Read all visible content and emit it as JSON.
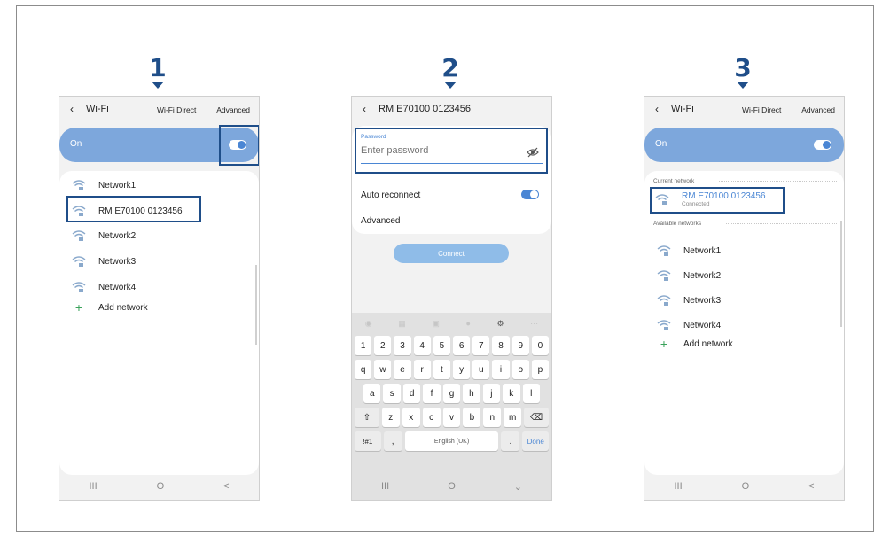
{
  "steps": [
    "1",
    "2",
    "3"
  ],
  "phone1": {
    "back_icon": "back-chevron",
    "title": "Wi-Fi",
    "wifi_direct": "Wi-Fi Direct",
    "advanced": "Advanced",
    "on_label": "On",
    "networks": [
      "Network1",
      "RM E70100 0123456",
      "Network2",
      "Network3",
      "Network4"
    ],
    "add_network": "Add network"
  },
  "phone2": {
    "back_icon": "back-chevron",
    "title": "RM E70100 0123456",
    "password_label": "Password",
    "password_placeholder": "Enter password",
    "auto_reconnect": "Auto reconnect",
    "advanced": "Advanced",
    "connect": "Connect",
    "keyboard": {
      "numbers": [
        "1",
        "2",
        "3",
        "4",
        "5",
        "6",
        "7",
        "8",
        "9",
        "0"
      ],
      "row1": [
        "q",
        "w",
        "e",
        "r",
        "t",
        "y",
        "u",
        "i",
        "o",
        "p"
      ],
      "row2": [
        "a",
        "s",
        "d",
        "f",
        "g",
        "h",
        "j",
        "k",
        "l"
      ],
      "row3": [
        "z",
        "x",
        "c",
        "v",
        "b",
        "n",
        "m"
      ],
      "symbols_key": "!#1",
      "comma": ",",
      "space_label": "English (UK)",
      "period": ".",
      "done": "Done"
    }
  },
  "phone3": {
    "back_icon": "back-chevron",
    "title": "Wi-Fi",
    "wifi_direct": "Wi-Fi Direct",
    "advanced": "Advanced",
    "on_label": "On",
    "current_network_label": "Current network",
    "current_network": "RM E70100 0123456",
    "current_status": "Connected",
    "available_networks_label": "Available networks",
    "networks": [
      "Network1",
      "Network2",
      "Network3",
      "Network4"
    ],
    "add_network": "Add network"
  },
  "nav": {
    "recents": "III",
    "home": "O",
    "back": "<"
  },
  "colors": {
    "accent": "#1f4e89",
    "toggle_bar": "#7da7dc",
    "link": "#4a86d4",
    "add_icon": "#3aa25a"
  }
}
